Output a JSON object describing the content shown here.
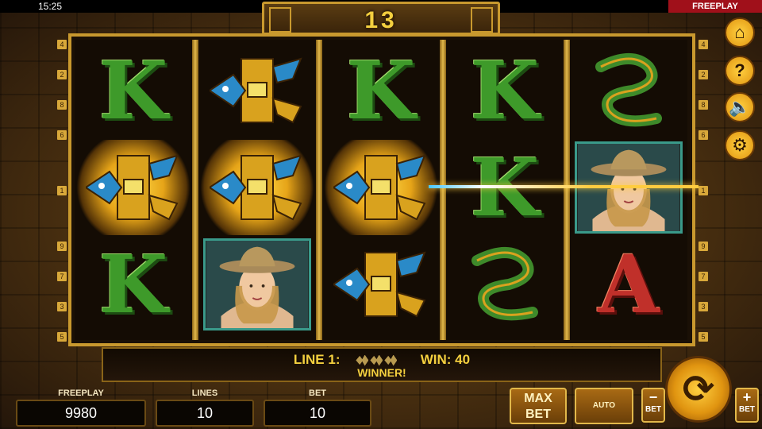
{
  "status": {
    "time": "15:25",
    "mode_badge": "FREEPLAY"
  },
  "header": {
    "counter": "13"
  },
  "reels": [
    [
      "K",
      "bird",
      "K"
    ],
    [
      "bird",
      "bird",
      "woman"
    ],
    [
      "K",
      "bird",
      "bird"
    ],
    [
      "K",
      "K",
      "snake"
    ],
    [
      "snake",
      "woman",
      "A"
    ]
  ],
  "win_positions": [
    [
      0,
      1
    ],
    [
      1,
      1
    ],
    [
      2,
      1
    ]
  ],
  "line_numbers": {
    "left": [
      "4",
      "2",
      "8",
      "6",
      "1",
      "9",
      "7",
      "3",
      "5"
    ],
    "right": [
      "4",
      "2",
      "8",
      "6",
      "1",
      "9",
      "7",
      "3",
      "5"
    ]
  },
  "symbols": {
    "K": "K",
    "A": "A"
  },
  "side_menu": [
    {
      "name": "home-icon",
      "glyph": "⌂"
    },
    {
      "name": "help-icon",
      "glyph": "?"
    },
    {
      "name": "sound-muted-icon",
      "glyph": "🔈"
    },
    {
      "name": "settings-gear-icon",
      "glyph": "⚙"
    }
  ],
  "win_bar": {
    "line_label": "LINE 1:",
    "win_label": "WIN: 40",
    "message": "WINNER!"
  },
  "footer": {
    "freeplay_label": "FREEPLAY",
    "freeplay_value": "9980",
    "lines_label": "LINES",
    "lines_value": "10",
    "bet_label": "BET",
    "bet_value": "10",
    "maxbet_line1": "MAX",
    "maxbet_line2": "BET",
    "auto_label": "AUTO",
    "bet_minus_sign": "−",
    "bet_minus_label": "BET",
    "bet_plus_sign": "+",
    "bet_plus_label": "BET",
    "spin_glyph": "⟳"
  },
  "colors": {
    "gold": "#c9992e",
    "green": "#3e9a2a",
    "red": "#c0302a",
    "badge": "#a0101a"
  }
}
